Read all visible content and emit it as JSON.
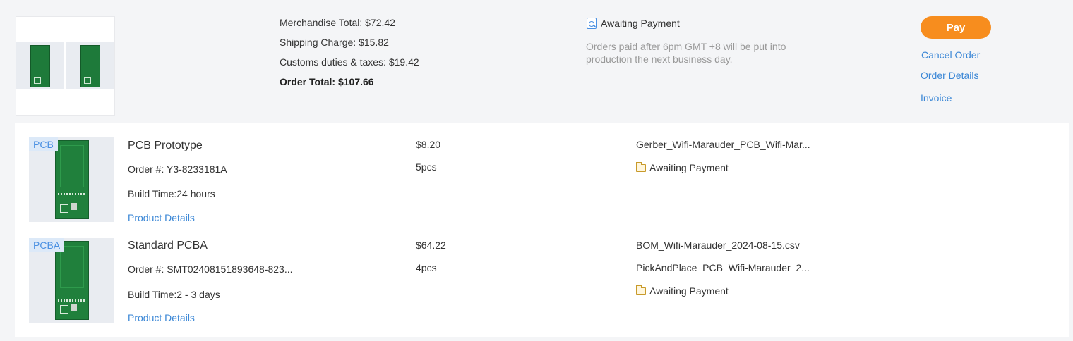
{
  "summary": {
    "merchandise_total": "Merchandise Total: $72.42",
    "shipping_charge": "Shipping Charge: $15.82",
    "customs": "Customs duties & taxes: $19.42",
    "order_total": "Order Total: $107.66"
  },
  "status": {
    "label": "Awaiting Payment",
    "note": "Orders paid after 6pm GMT +8 will be put into production the next business day."
  },
  "actions": {
    "pay": "Pay",
    "cancel": "Cancel Order",
    "details": "Order Details",
    "invoice": "Invoice"
  },
  "items": [
    {
      "badge": "PCB",
      "title": "PCB Prototype",
      "order_no": "Order #: Y3-8233181A",
      "build_time": "Build Time:24 hours",
      "details_link": "Product Details",
      "price": "$8.20",
      "qty": "5pcs",
      "files": [
        "Gerber_Wifi-Marauder_PCB_Wifi-Mar..."
      ],
      "status": "Awaiting Payment"
    },
    {
      "badge": "PCBA",
      "title": "Standard PCBA",
      "order_no": "Order #: SMT02408151893648-823...",
      "build_time": "Build Time:2 - 3 days",
      "details_link": "Product Details",
      "price": "$64.22",
      "qty": "4pcs",
      "files": [
        "BOM_Wifi-Marauder_2024-08-15.csv",
        "PickAndPlace_PCB_Wifi-Marauder_2..."
      ],
      "status": "Awaiting Payment"
    }
  ],
  "icons": {
    "status_top": "document-search-icon",
    "item_status": "folder-icon"
  },
  "colors": {
    "pay_button": "#f78d1e",
    "link": "#3b87d6",
    "badge_bg": "#dce9f8"
  }
}
